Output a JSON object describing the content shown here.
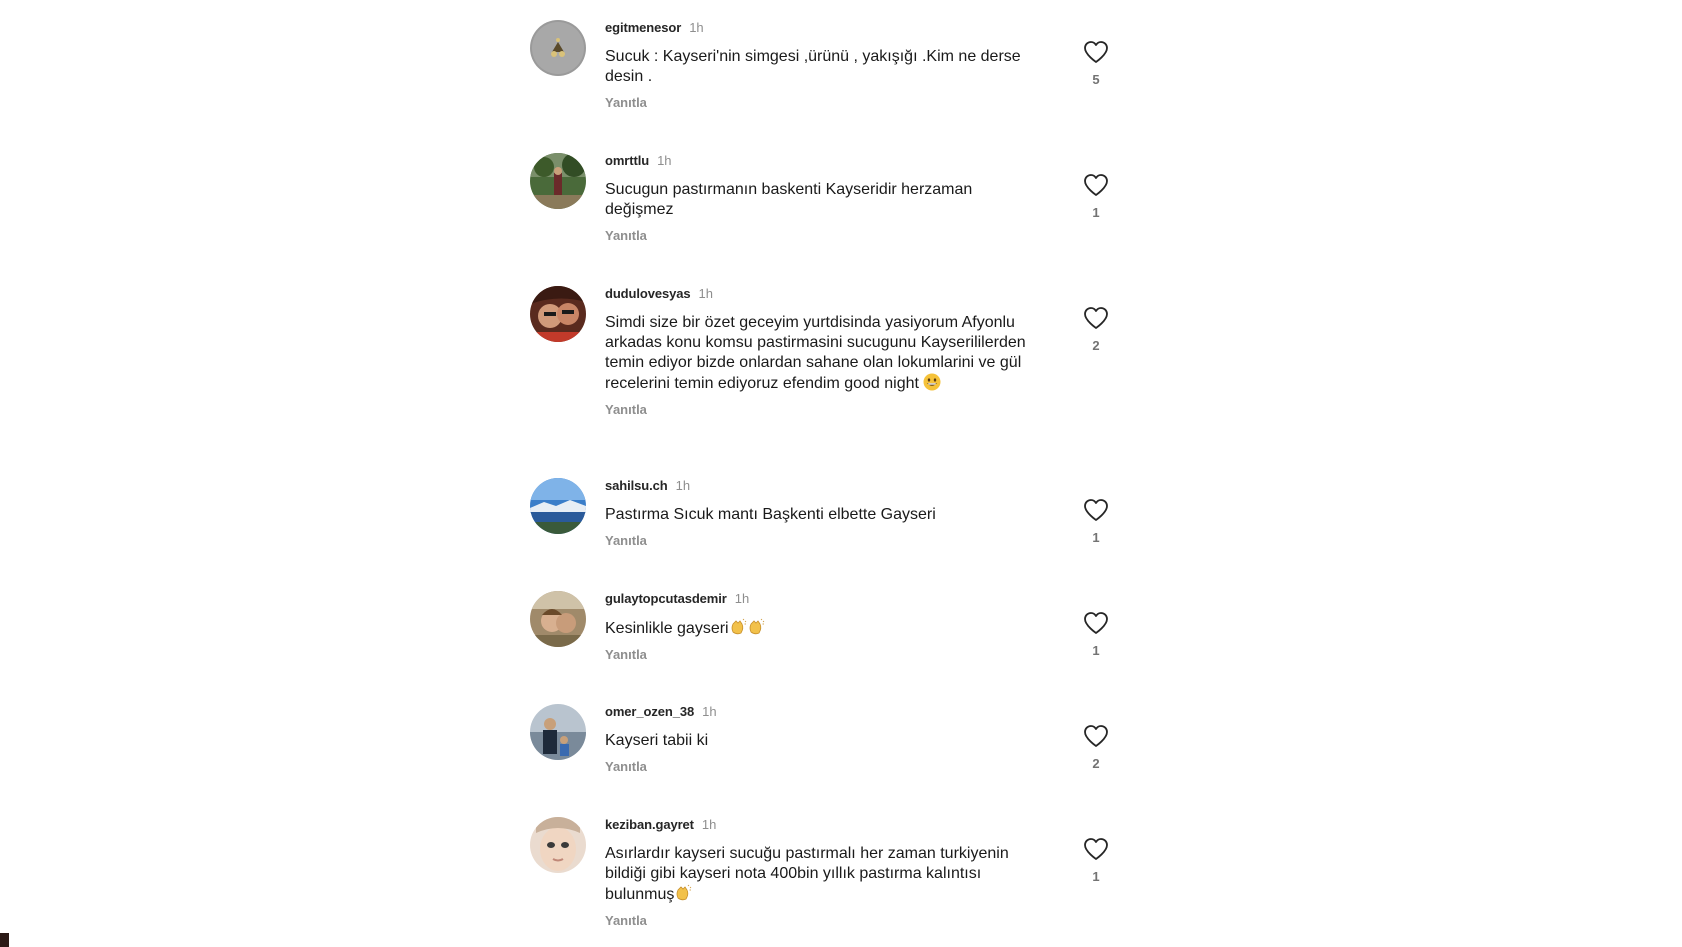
{
  "reply_label": "Yanıtla",
  "comments": [
    {
      "username": "egitmenesor",
      "time": "1h",
      "text": "Sucuk : Kayseri'nin simgesi ,ürünü , yakışığı .Kim ne derse desin .",
      "likes": "5",
      "avatar": "avatar-egitmenesor"
    },
    {
      "username": "omrttlu",
      "time": "1h",
      "text": "Sucugun pastırmanın baskenti Kayseridir herzaman değişmez",
      "likes": "1",
      "avatar": "avatar-omrttlu"
    },
    {
      "username": "dudulovesyas",
      "time": "1h",
      "text": "Simdi size bir özet geceyim yurtdisinda yasiyorum Afyonlu arkadas konu komsu pastirmasini sucugunu Kayserililerden temin ediyor bizde onlardan sahane olan lokumlarini ve gül recelerini temin ediyoruz efendim good night",
      "emoji": "grinning-face",
      "likes": "2",
      "avatar": "avatar-dudulovesyas"
    },
    {
      "username": "sahilsu.ch",
      "time": "1h",
      "text": "Pastırma Sıcuk mantı Başkenti elbette Gayseri",
      "likes": "1",
      "avatar": "avatar-sahilsu"
    },
    {
      "username": "gulaytopcutasdemir",
      "time": "1h",
      "text": "Kesinlikle gayseri",
      "emoji": "clapping-hands x2",
      "likes": "1",
      "avatar": "avatar-gulaytopcutasdemir"
    },
    {
      "username": "omer_ozen_38",
      "time": "1h",
      "text": "Kayseri tabii ki",
      "likes": "2",
      "avatar": "avatar-omer-ozen"
    },
    {
      "username": "keziban.gayret",
      "time": "1h",
      "text": "Asırlardır kayseri sucuğu pastırmalı her zaman turkiyenin bildiği gibi kayseri nota 400bin yıllık pastırma kalıntısı bulunmuş",
      "emoji": "clapping-hands",
      "likes": "1",
      "avatar": "avatar-keziban"
    }
  ],
  "colors": {
    "username": "#262626",
    "secondary": "#8e8e8e",
    "like_icon": "#262626"
  },
  "icons": {
    "like": "heart-outline-icon"
  }
}
